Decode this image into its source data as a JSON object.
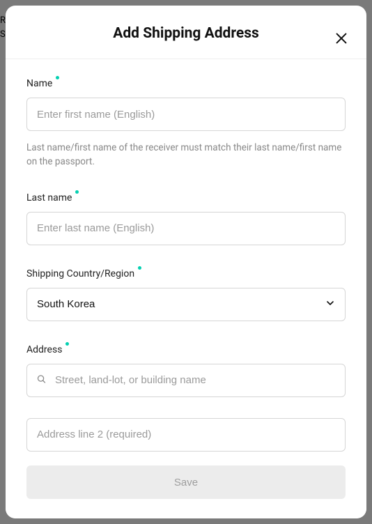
{
  "background": {
    "frag1": "RI",
    "frag2": "S"
  },
  "modal": {
    "title": "Add Shipping Address",
    "fields": {
      "name": {
        "label": "Name",
        "placeholder": "Enter first name (English)",
        "helper": "Last name/first name of the receiver must match their last name/first name on the passport."
      },
      "lastName": {
        "label": "Last name",
        "placeholder": "Enter last name (English)"
      },
      "country": {
        "label": "Shipping Country/Region",
        "selected": "South Korea"
      },
      "address": {
        "label": "Address",
        "placeholder": "Street, land-lot, or building name"
      },
      "address2": {
        "placeholder": "Address line 2 (required)"
      }
    },
    "footer": {
      "saveLabel": "Save"
    }
  }
}
